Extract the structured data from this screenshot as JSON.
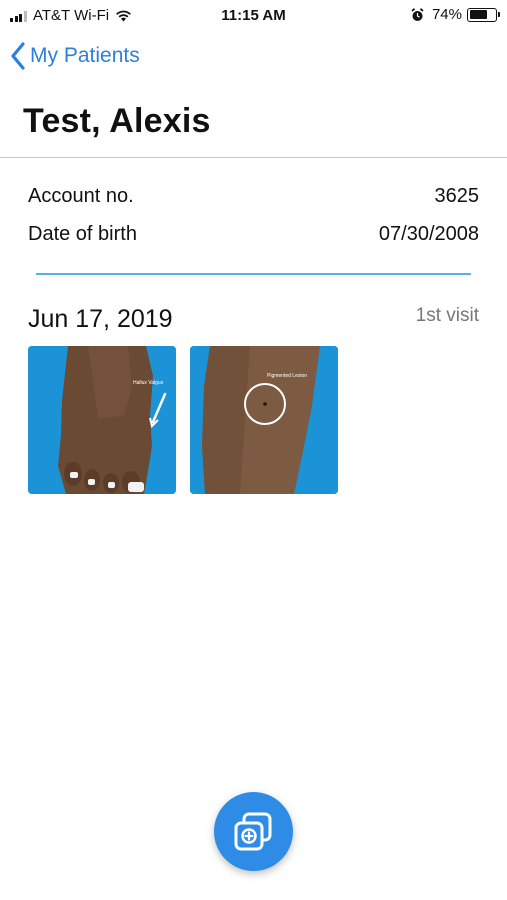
{
  "status_bar": {
    "carrier": "AT&T Wi-Fi",
    "time": "11:15 AM",
    "battery_percent_text": "74%",
    "battery_level": 0.74,
    "signal_bars": 3
  },
  "nav": {
    "back_label": "My Patients"
  },
  "patient": {
    "name": "Test, Alexis"
  },
  "info": {
    "account_label": "Account no.",
    "account_value": "3625",
    "dob_label": "Date of birth",
    "dob_value": "07/30/2008"
  },
  "visit": {
    "date": "Jun 17, 2019",
    "count_label": "1st visit",
    "photos": [
      {
        "caption": "Hallux Valgus"
      },
      {
        "caption": "Pigmented Lesion"
      }
    ]
  },
  "fab": {
    "icon": "add-photo-icon"
  },
  "colors": {
    "accent": "#2d7fdc",
    "divider_blue": "#5aaee0",
    "fab": "#2f8ce6",
    "photo_bg": "#1b93d6"
  }
}
